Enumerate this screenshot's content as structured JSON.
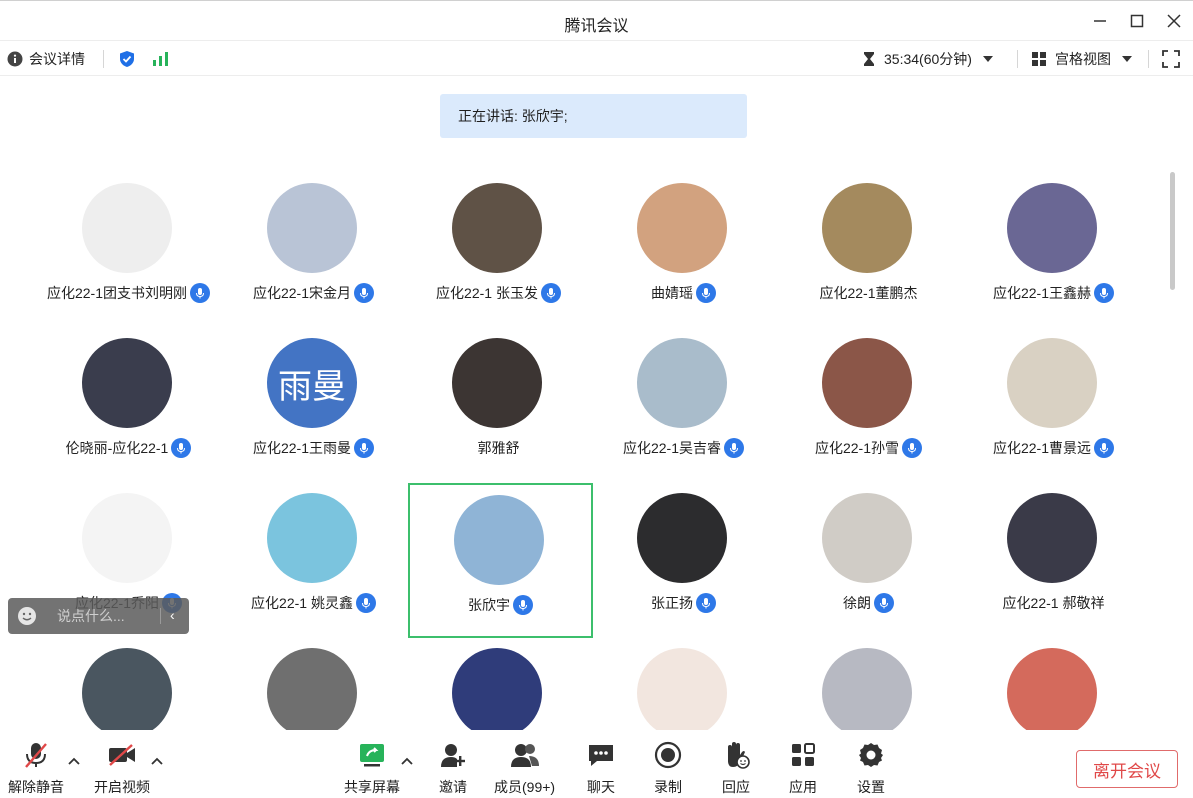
{
  "window": {
    "title": "腾讯会议"
  },
  "infobar": {
    "meeting_details": "会议详情",
    "timer": "35:34(60分钟)",
    "view_mode": "宫格视图"
  },
  "speaking_banner": "正在讲话: 张欣宇;",
  "participants": [
    {
      "name": "应化22-1团支书刘明刚",
      "mic": true,
      "avatar_text": "",
      "bg": "#eeeeee"
    },
    {
      "name": "应化22-1宋金月",
      "mic": true,
      "avatar_text": "",
      "bg": "#b9c4d6"
    },
    {
      "name": "应化22-1 张玉发",
      "mic": true,
      "avatar_text": "",
      "bg": "#5f5246"
    },
    {
      "name": "曲婧瑶",
      "mic": true,
      "avatar_text": "",
      "bg": "#d2a27f"
    },
    {
      "name": "应化22-1董鹏杰",
      "mic": false,
      "avatar_text": "",
      "bg": "#a48a5e"
    },
    {
      "name": "应化22-1王鑫赫",
      "mic": true,
      "avatar_text": "",
      "bg": "#6a6794"
    },
    {
      "name": "伦晓丽-应化22-1",
      "mic": true,
      "avatar_text": "",
      "bg": "#3a3d4d"
    },
    {
      "name": "应化22-1王雨曼",
      "mic": true,
      "avatar_text": "雨曼",
      "bg": "#4374c4"
    },
    {
      "name": "郭雅舒",
      "mic": false,
      "avatar_text": "",
      "bg": "#3c3533"
    },
    {
      "name": "应化22-1吴吉睿",
      "mic": true,
      "avatar_text": "",
      "bg": "#a9bccb"
    },
    {
      "name": "应化22-1孙雪",
      "mic": true,
      "avatar_text": "",
      "bg": "#8b5648"
    },
    {
      "name": "应化22-1曹景远",
      "mic": true,
      "avatar_text": "",
      "bg": "#d9d1c3"
    },
    {
      "name": "应化22-1乔阳",
      "mic": true,
      "avatar_text": "",
      "bg": "#f4f4f4"
    },
    {
      "name": "应化22-1 姚灵鑫",
      "mic": true,
      "avatar_text": "",
      "bg": "#7bc4de"
    },
    {
      "name": "张欣宇",
      "mic": true,
      "avatar_text": "",
      "bg": "#8fb4d6",
      "speaking": true
    },
    {
      "name": "张正扬",
      "mic": true,
      "avatar_text": "",
      "bg": "#2c2c2e"
    },
    {
      "name": "徐朗",
      "mic": true,
      "avatar_text": "",
      "bg": "#d0ccc6"
    },
    {
      "name": "应化22-1 郝敬祥",
      "mic": false,
      "avatar_text": "",
      "bg": "#3a3a48"
    },
    {
      "name": "",
      "mic": false,
      "avatar_text": "",
      "bg": "#4a5660"
    },
    {
      "name": "",
      "mic": false,
      "avatar_text": "",
      "bg": "#6f6f6f"
    },
    {
      "name": "",
      "mic": false,
      "avatar_text": "",
      "bg": "#2f3c7a"
    },
    {
      "name": "",
      "mic": false,
      "avatar_text": "",
      "bg": "#f2e6df"
    },
    {
      "name": "",
      "mic": false,
      "avatar_text": "",
      "bg": "#b7b9c2"
    },
    {
      "name": "",
      "mic": false,
      "avatar_text": "",
      "bg": "#d46a5c"
    }
  ],
  "chat": {
    "placeholder": "说点什么..."
  },
  "toolbar": {
    "unmute": "解除静音",
    "start_video": "开启视频",
    "share_screen": "共享屏幕",
    "invite": "邀请",
    "members": "成员(99+)",
    "chat": "聊天",
    "record": "录制",
    "react": "回应",
    "apps": "应用",
    "settings": "设置",
    "leave": "离开会议"
  },
  "colors": {
    "accent_blue": "#2e78e8",
    "active_green": "#3cbf6c",
    "leave_red": "#e04848"
  }
}
